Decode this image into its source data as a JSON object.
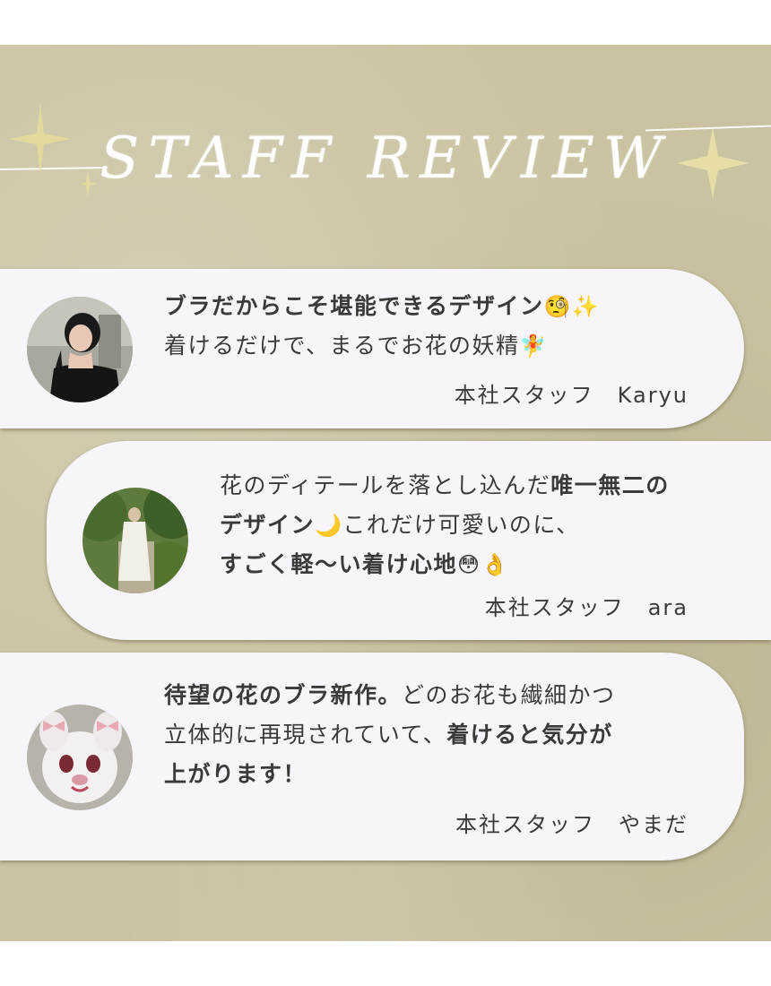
{
  "header": {
    "title": "STAFF REVIEW"
  },
  "reviews": [
    {
      "line1": "ブラだからこそ堪能できるデザイン",
      "line1_emoji": "🧐✨",
      "line2": "着けるだけで、まるでお花の妖精",
      "line2_emoji": "🧚",
      "signature": "本社スタッフ　Karyu"
    },
    {
      "line1_a": "花のディテールを落とし込んだ",
      "line1_b": "唯一無二の",
      "line2_a": "デザイン",
      "line2_emoji": "🌙",
      "line2_b": "これだけ可愛いのに、",
      "line3_a": "すごく軽〜い着け心地",
      "line3_emoji": "😳👌",
      "signature": "本社スタッフ　ara"
    },
    {
      "line1_a": "待望の花のブラ新作。",
      "line1_b": "どのお花も繊細かつ",
      "line2_a": "立体的に再現されていて、",
      "line2_b": "着けると気分が",
      "line3": "上がります！",
      "signature": "本社スタッフ　やまだ"
    }
  ],
  "colors": {
    "background": "#c9c3a1",
    "card": "#f7f5f9",
    "text": "#3a3a3a",
    "title": "#ffffff"
  }
}
